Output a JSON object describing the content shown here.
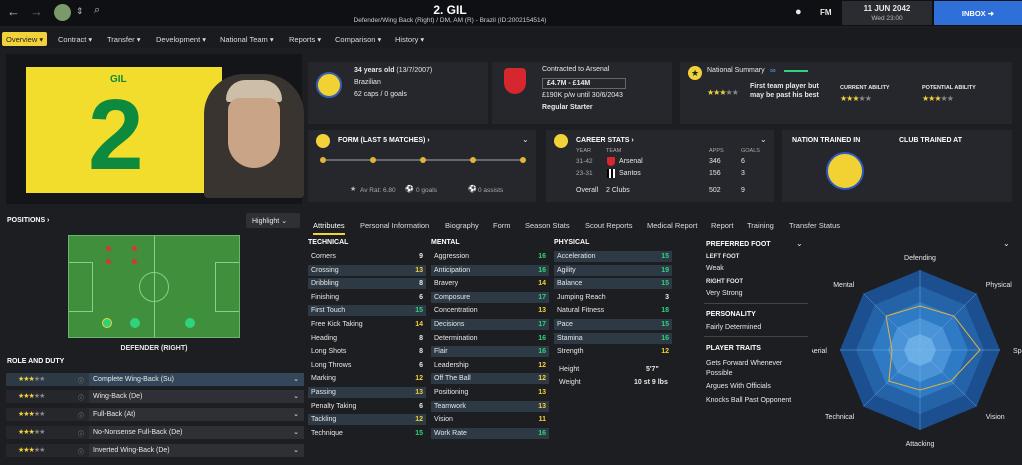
{
  "topbar": {
    "title": "2. GIL",
    "subtitle": "Defender/Wing Back (Right) / DM, AM (R) - Brazil (ID:2002154514)",
    "fm_label": "FM",
    "date_line1": "11 JUN 2042",
    "date_line2": "Wed 23:00",
    "inbox_label": "INBOX"
  },
  "menu": [
    {
      "label": "Overview ▾"
    },
    {
      "label": "Contract ▾"
    },
    {
      "label": "Transfer ▾"
    },
    {
      "label": "Development ▾"
    },
    {
      "label": "National Team ▾"
    },
    {
      "label": "Reports ▾"
    },
    {
      "label": "Comparison ▾"
    },
    {
      "label": "History ▾"
    }
  ],
  "hero": {
    "short_name": "GIL",
    "number": "2"
  },
  "bio": {
    "age": "34 years old",
    "dob": "(13/7/2007)",
    "nationality": "Brazilian",
    "caps": "62 caps / 0 goals"
  },
  "contract": {
    "line1": "Contracted to Arsenal",
    "value": "£4.7M - £14M",
    "wage": "£190K p/w until 30/6/2043",
    "status": "Regular Starter"
  },
  "national": {
    "title": "National Summary",
    "text": "First team player but may be past his best",
    "current_label": "CURRENT ABILITY",
    "potential_label": "POTENTIAL ABILITY"
  },
  "form": {
    "title": "FORM (LAST 5 MATCHES) ›",
    "rating": "Av Rat: 6.80",
    "goals": "0 goals",
    "assists": "0 assists",
    "values": [
      6.8,
      6.8,
      6.8,
      6.8,
      6.8
    ]
  },
  "career": {
    "title": "CAREER STATS ›",
    "h_year": "YEAR",
    "h_team": "TEAM",
    "h_apps": "APPS",
    "h_goals": "GOALS",
    "rows": [
      {
        "year": "31-42",
        "team": "Arsenal",
        "apps": "346",
        "goals": "6"
      },
      {
        "year": "23-31",
        "team": "Santos",
        "apps": "156",
        "goals": "3"
      }
    ],
    "overall_label": "Overall",
    "overall_team": "2 Clubs",
    "overall_apps": "502",
    "overall_goals": "9"
  },
  "trained": {
    "nation": "NATION TRAINED IN",
    "club": "CLUB TRAINED AT"
  },
  "positions": {
    "title": "POSITIONS ›",
    "highlight": "Highlight",
    "caption": "DEFENDER (RIGHT)"
  },
  "roles": {
    "title": "ROLE AND DUTY",
    "items": [
      {
        "label": "Complete Wing-Back (Su)"
      },
      {
        "label": "Wing-Back (De)"
      },
      {
        "label": "Full-Back (At)"
      },
      {
        "label": "No-Nonsense Full-Back (De)"
      },
      {
        "label": "Inverted Wing-Back (De)"
      }
    ]
  },
  "tabs": [
    {
      "label": "Attributes"
    },
    {
      "label": "Personal Information"
    },
    {
      "label": "Biography"
    },
    {
      "label": "Form"
    },
    {
      "label": "Season Stats"
    },
    {
      "label": "Scout Reports"
    },
    {
      "label": "Medical Report"
    },
    {
      "label": "Report"
    },
    {
      "label": "Training"
    },
    {
      "label": "Transfer Status"
    }
  ],
  "technical": {
    "title": "TECHNICAL",
    "items": [
      {
        "name": "Corners",
        "value": "9"
      },
      {
        "name": "Crossing",
        "value": "13"
      },
      {
        "name": "Dribbling",
        "value": "8"
      },
      {
        "name": "Finishing",
        "value": "6"
      },
      {
        "name": "First Touch",
        "value": "15"
      },
      {
        "name": "Free Kick Taking",
        "value": "14"
      },
      {
        "name": "Heading",
        "value": "8"
      },
      {
        "name": "Long Shots",
        "value": "8"
      },
      {
        "name": "Long Throws",
        "value": "6"
      },
      {
        "name": "Marking",
        "value": "12"
      },
      {
        "name": "Passing",
        "value": "13"
      },
      {
        "name": "Penalty Taking",
        "value": "6"
      },
      {
        "name": "Tackling",
        "value": "12"
      },
      {
        "name": "Technique",
        "value": "15"
      }
    ]
  },
  "mental": {
    "title": "MENTAL",
    "items": [
      {
        "name": "Aggression",
        "value": "16"
      },
      {
        "name": "Anticipation",
        "value": "16"
      },
      {
        "name": "Bravery",
        "value": "14"
      },
      {
        "name": "Composure",
        "value": "17"
      },
      {
        "name": "Concentration",
        "value": "13"
      },
      {
        "name": "Decisions",
        "value": "17"
      },
      {
        "name": "Determination",
        "value": "16"
      },
      {
        "name": "Flair",
        "value": "16"
      },
      {
        "name": "Leadership",
        "value": "12"
      },
      {
        "name": "Off The Ball",
        "value": "12"
      },
      {
        "name": "Positioning",
        "value": "13"
      },
      {
        "name": "Teamwork",
        "value": "13"
      },
      {
        "name": "Vision",
        "value": "11"
      },
      {
        "name": "Work Rate",
        "value": "16"
      }
    ]
  },
  "physical": {
    "title": "PHYSICAL",
    "items": [
      {
        "name": "Acceleration",
        "value": "15"
      },
      {
        "name": "Agility",
        "value": "19"
      },
      {
        "name": "Balance",
        "value": "15"
      },
      {
        "name": "Jumping Reach",
        "value": "3"
      },
      {
        "name": "Natural Fitness",
        "value": "18"
      },
      {
        "name": "Pace",
        "value": "15"
      },
      {
        "name": "Stamina",
        "value": "16"
      },
      {
        "name": "Strength",
        "value": "12"
      }
    ],
    "height_label": "Height",
    "height": "5'7\"",
    "weight_label": "Weight",
    "weight": "10 st 9 lbs"
  },
  "foot": {
    "title": "PREFERRED FOOT",
    "left_label": "LEFT FOOT",
    "left": "Weak",
    "right_label": "RIGHT FOOT",
    "right": "Very Strong"
  },
  "personality": {
    "title": "PERSONALITY",
    "value": "Fairly Determined"
  },
  "traits": {
    "title": "PLAYER TRAITS",
    "items": [
      "Gets Forward Whenever Possible",
      "Argues With Officials",
      "Knocks Ball Past Opponent"
    ]
  },
  "radar": {
    "labels": [
      "Defending",
      "Physical",
      "Speed",
      "Vision",
      "Attacking",
      "Technical",
      "Aerial",
      "Mental"
    ],
    "values": [
      0.55,
      0.6,
      0.75,
      0.55,
      0.5,
      0.55,
      0.35,
      0.6
    ]
  }
}
